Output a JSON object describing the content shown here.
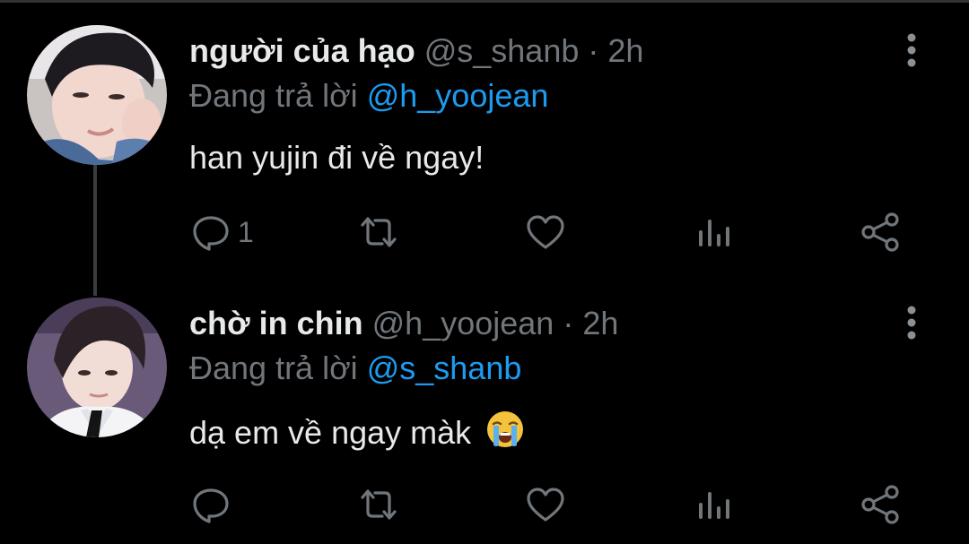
{
  "colors": {
    "background": "#000000",
    "text": "#e7e9ea",
    "muted": "#71767b",
    "accent": "#1d9bf0"
  },
  "tweets": [
    {
      "display_name": "người của hạo",
      "handle": "@s_shanb",
      "separator": "·",
      "time": "2h",
      "reply_prefix": "Đang trả lời",
      "reply_to": "@h_yoojean",
      "text": "han yujin đi về ngay!",
      "reply_count": "1"
    },
    {
      "display_name": "chờ in chin",
      "handle": "@h_yoojean",
      "separator": "·",
      "time": "2h",
      "reply_prefix": "Đang trả lời",
      "reply_to": "@s_shanb",
      "text": "dạ em về ngay màk",
      "emoji": "loudly-crying-face",
      "reply_count": ""
    }
  ],
  "icons": {
    "reply": "reply-icon",
    "retweet": "retweet-icon",
    "like": "heart-icon",
    "views": "analytics-icon",
    "share": "share-icon",
    "more": "more-vertical-icon"
  }
}
